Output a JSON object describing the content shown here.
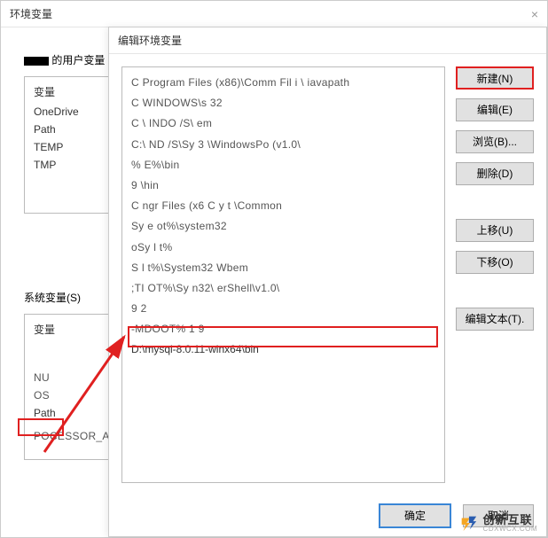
{
  "outer": {
    "title": "环境变量",
    "close": "×",
    "user_vars_label": "的用户变量",
    "user_header": "变量",
    "user_items": [
      "OneDrive",
      "Path",
      "TEMP",
      "TMP"
    ],
    "sys_vars_label": "系统变量(S)",
    "sys_header": "变量",
    "sys_items": [
      "NU",
      "OS",
      "Path",
      "POCESSOR_A"
    ]
  },
  "inner": {
    "title": "编辑环境变量",
    "close": "",
    "paths": [
      "C    Program Files (x86)\\Comm     Fil          i     \\ iavapath",
      "C   WINDOWS\\s        32",
      "C  \\ INDO  /S\\                         em",
      "C:\\    ND    /S\\Sy         3 \\WindowsPo            (v1.0\\",
      "%                  E%\\bin",
      "9                          \\hin",
      "C     ngr     Files (x6            C                  y  t  \\Common",
      "  Sy e        ot%\\system32",
      " oSy     l     t%",
      " S      l      t%\\System32  Wbem",
      "    ;TI      OT%\\Sy      n32\\                  erShell\\v1.0\\",
      "9    2       ",
      "         -MDOOT% 1  9                           ",
      "D:\\mysql-8.0.11-winx64\\bin"
    ],
    "highlight_index": 13,
    "buttons": {
      "new": "新建(N)",
      "edit": "编辑(E)",
      "browse": "浏览(B)...",
      "delete": "删除(D)",
      "up": "上移(U)",
      "down": "下移(O)",
      "edittext": "编辑文本(T).",
      "ok": "确定",
      "cancel": "取消"
    }
  },
  "watermark": {
    "main": "创新互联",
    "sub": "CDXWCX.COM"
  }
}
